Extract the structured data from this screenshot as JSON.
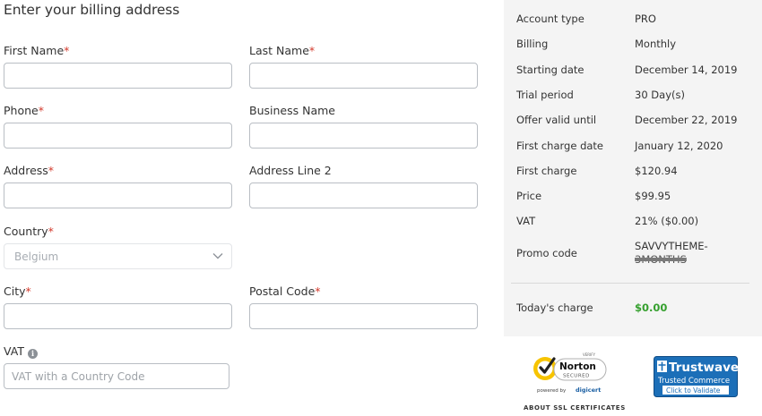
{
  "form": {
    "title": "Enter your billing address",
    "required_mark": "*",
    "fields": {
      "first_name": "First Name",
      "last_name": "Last Name",
      "phone": "Phone",
      "business_name": "Business Name",
      "address": "Address",
      "address_line2": "Address Line 2",
      "country": "Country",
      "country_value": "Belgium",
      "city": "City",
      "postal_code": "Postal Code",
      "vat": "VAT",
      "vat_placeholder": "VAT with a Country Code"
    }
  },
  "summary": {
    "rows": [
      {
        "label": "Account type",
        "value": "PRO"
      },
      {
        "label": "Billing",
        "value": "Monthly"
      },
      {
        "label": "Starting date",
        "value": "December 14, 2019"
      },
      {
        "label": "Trial period",
        "value": "30 Day(s)"
      },
      {
        "label": "Offer valid until",
        "value": "December 22, 2019"
      },
      {
        "label": "First charge date",
        "value": "January 12, 2020"
      },
      {
        "label": "First charge",
        "value": "$120.94"
      },
      {
        "label": "Price",
        "value": "$99.95"
      },
      {
        "label": "VAT",
        "value": "21% ($0.00)"
      }
    ],
    "promo_label": "Promo code",
    "promo_value": "SAVVYTHEME-",
    "promo_value_struck": "3MONTHS",
    "today_label": "Today's charge",
    "today_value": "$0.00",
    "today_color": "#35a02e"
  },
  "badges": {
    "norton": {
      "verify": "VERIFY",
      "name": "Norton",
      "secured": "SECURED",
      "powered": "powered by",
      "digicert": "digicert",
      "ssl_link": "ABOUT SSL CERTIFICATES"
    },
    "trustwave": {
      "name": "Trustwave",
      "line1": "Trusted Commerce",
      "line2": "Click to Validate"
    }
  },
  "colors": {
    "required": "#d33a2c",
    "summary_bg": "#f4f4f4",
    "trustwave_blue": "#1c6fb8",
    "norton_yellow": "#f7c400"
  }
}
